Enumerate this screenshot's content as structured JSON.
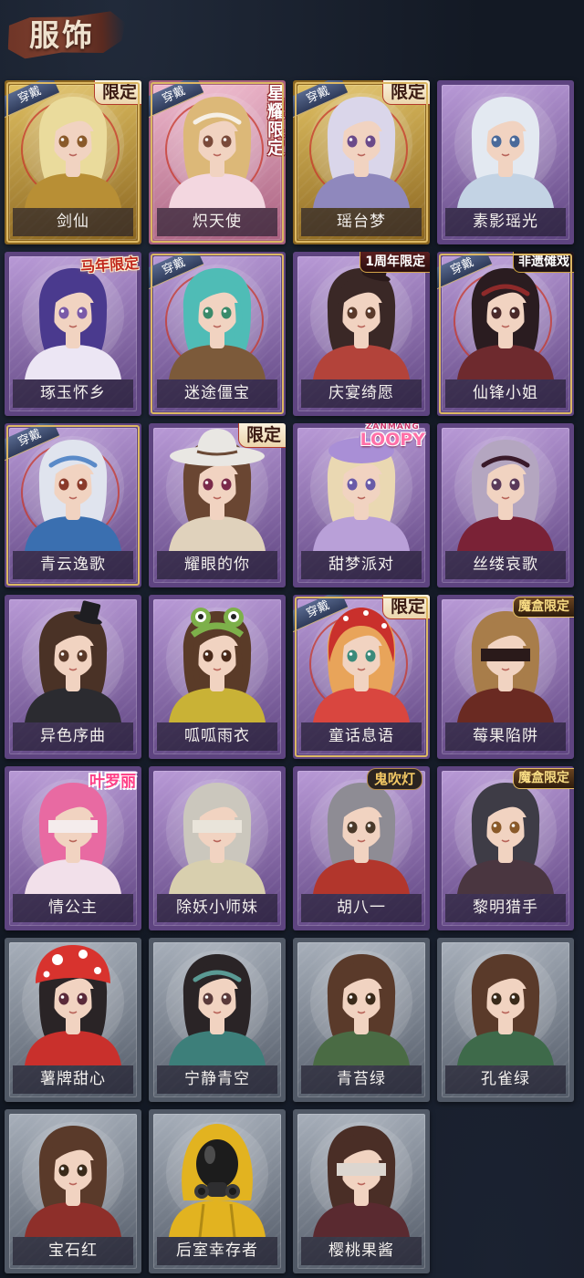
{
  "header": {
    "title": "服饰"
  },
  "badges": {
    "equipped_label": "穿戴"
  },
  "frame_colors": {
    "gold": {
      "light": "#e0c062",
      "dark": "#8a6520"
    },
    "pink": {
      "light": "#efb8cc",
      "dark": "#a8607f"
    },
    "purple": {
      "light": "#b899d6",
      "dark": "#5e4480"
    },
    "grey": {
      "light": "#a7afba",
      "dark": "#515966"
    }
  },
  "costumes": {
    "items": [
      {
        "name": "剑仙",
        "frame": "gold",
        "equipped": true,
        "tag": "限定",
        "hair": "#eadb9c",
        "outfit": "#b88f35",
        "eyes": "#8a5a2a"
      },
      {
        "name": "炽天使",
        "frame": "pink",
        "equipped": true,
        "tag": "星耀限定",
        "hair": "#dcb878",
        "outfit": "#f3d7e0",
        "eyes": "#7a4a3a",
        "accessory": "headband",
        "accessory_color": "#f6f0e6"
      },
      {
        "name": "瑶台梦",
        "frame": "gold",
        "equipped": true,
        "tag": "限定",
        "hair": "#dad6ea",
        "outfit": "#8f88bd",
        "eyes": "#6a4a8a"
      },
      {
        "name": "素影瑶光",
        "frame": "purple",
        "hair": "#e3e9f1",
        "outfit": "#c3d3e4",
        "eyes": "#4a6a9a"
      },
      {
        "name": "琢玉怀乡",
        "frame": "purple",
        "tag": "马年限定",
        "hair": "#4a3a8e",
        "outfit": "#ece6f4",
        "eyes": "#7a5aa8"
      },
      {
        "name": "迷途僵宝",
        "frame": "purple",
        "equipped": true,
        "hair": "#4fbcb6",
        "outfit": "#7c5a3a",
        "eyes": "#3a8a6a"
      },
      {
        "name": "庆宴绮愿",
        "frame": "purple",
        "tag": "1周年限定",
        "hair": "#3a2826",
        "outfit": "#b3433a",
        "eyes": "#5a3a2a",
        "accessory": "top-hat",
        "accessory_color": "#2a1a1a"
      },
      {
        "name": "仙锋小姐",
        "frame": "purple",
        "equipped": true,
        "tag": "非遗傩戏",
        "hair": "#2a1c20",
        "outfit": "#6e2a2e",
        "eyes": "#4a2a2a",
        "accessory": "headband",
        "accessory_color": "#8e2a2a"
      },
      {
        "name": "青云逸歌",
        "frame": "purple",
        "equipped": true,
        "hair": "#e0e4ee",
        "outfit": "#3a6fb0",
        "eyes": "#8a3a2a",
        "accessory": "headband",
        "accessory_color": "#5a8ac8"
      },
      {
        "name": "耀眼的你",
        "frame": "purple",
        "tag": "限定",
        "hair": "#6a4632",
        "outfit": "#e0d2bc",
        "eyes": "#7a2a4a",
        "accessory": "cowboy-hat",
        "accessory_color": "#e9e7e3"
      },
      {
        "name": "甜梦派对",
        "frame": "purple",
        "tag": "LOOPY",
        "tag_top": "ZANMANG",
        "hair": "#ead8b2",
        "outfit": "#b9a0d8",
        "eyes": "#6a5aa8",
        "accessory": "beret",
        "accessory_color": "#a98fd6"
      },
      {
        "name": "丝缕哀歌",
        "frame": "purple",
        "hair": "#b4a6c0",
        "outfit": "#7a2236",
        "eyes": "#5a3a5a",
        "accessory": "headband",
        "accessory_color": "#3a1a2a"
      },
      {
        "name": "异色序曲",
        "frame": "purple",
        "hair": "#4a3226",
        "outfit": "#2b2b30",
        "eyes": "#5a3a2a",
        "accessory": "top-hat",
        "accessory_color": "#1e1e22"
      },
      {
        "name": "呱呱雨衣",
        "frame": "purple",
        "hair": "#5a3b28",
        "outfit": "#c9b236",
        "eyes": "#4a2a1a",
        "accessory": "frog-hat",
        "accessory_color": "#7db04a"
      },
      {
        "name": "童话息语",
        "frame": "purple",
        "equipped": true,
        "tag": "限定",
        "hair": "#e8a45a",
        "outfit": "#d9463f",
        "eyes": "#3a8a7a",
        "accessory": "bonnet",
        "accessory_color": "#c9302c"
      },
      {
        "name": "莓果陷阱",
        "frame": "purple",
        "tag": "魔盒限定",
        "hair": "#a87d4a",
        "outfit": "#6a2a22",
        "accessory": "blindfold",
        "accessory_color": "#2a1a1a"
      },
      {
        "name": "情公主",
        "frame": "purple",
        "tag": "叶罗丽",
        "hair": "#e86aa2",
        "outfit": "#f2e0ea",
        "accessory": "blindfold",
        "accessory_color": "#f4ecec"
      },
      {
        "name": "除妖小师妹",
        "frame": "purple",
        "hair": "#cbc7bd",
        "outfit": "#d8cfae",
        "accessory": "blindfold",
        "accessory_color": "#e9e4da"
      },
      {
        "name": "胡八一",
        "frame": "purple",
        "tag": "鬼吹灯",
        "hair": "#8e8c94",
        "outfit": "#b2362c",
        "eyes": "#4a3a2a"
      },
      {
        "name": "黎明猎手",
        "frame": "purple",
        "tag": "魔盒限定",
        "hair": "#3e3c46",
        "outfit": "#4a3640",
        "eyes": "#8a5a2a"
      },
      {
        "name": "薯牌甜心",
        "frame": "grey",
        "hair": "#2a2426",
        "outfit": "#c9302c",
        "eyes": "#5a2a3a",
        "accessory": "mushroom-hat",
        "accessory_color": "#d8332e"
      },
      {
        "name": "宁静青空",
        "frame": "grey",
        "hair": "#2a2426",
        "outfit": "#3d7f7a",
        "eyes": "#5a3a3a",
        "accessory": "headband",
        "accessory_color": "#5a9a94"
      },
      {
        "name": "青苔绿",
        "frame": "grey",
        "hair": "#5a3a2a",
        "outfit": "#4a6b44",
        "eyes": "#3a2a1a"
      },
      {
        "name": "孔雀绿",
        "frame": "grey",
        "hair": "#5a3a2a",
        "outfit": "#3e6a4a",
        "eyes": "#3a2a1a"
      },
      {
        "name": "宝石红",
        "frame": "grey",
        "hair": "#5a3a2a",
        "outfit": "#8e2f2a",
        "eyes": "#3a2a1a"
      },
      {
        "name": "后室幸存者",
        "frame": "grey",
        "hair": "#e2b320",
        "outfit": "#e2b320",
        "accessory": "gas-mask-hood",
        "accessory_color": "#1c1c1c"
      },
      {
        "name": "樱桃果酱",
        "frame": "grey",
        "hair": "#4a2e26",
        "outfit": "#5a2a30",
        "accessory": "blindfold",
        "accessory_color": "#dcd6d0"
      }
    ]
  }
}
